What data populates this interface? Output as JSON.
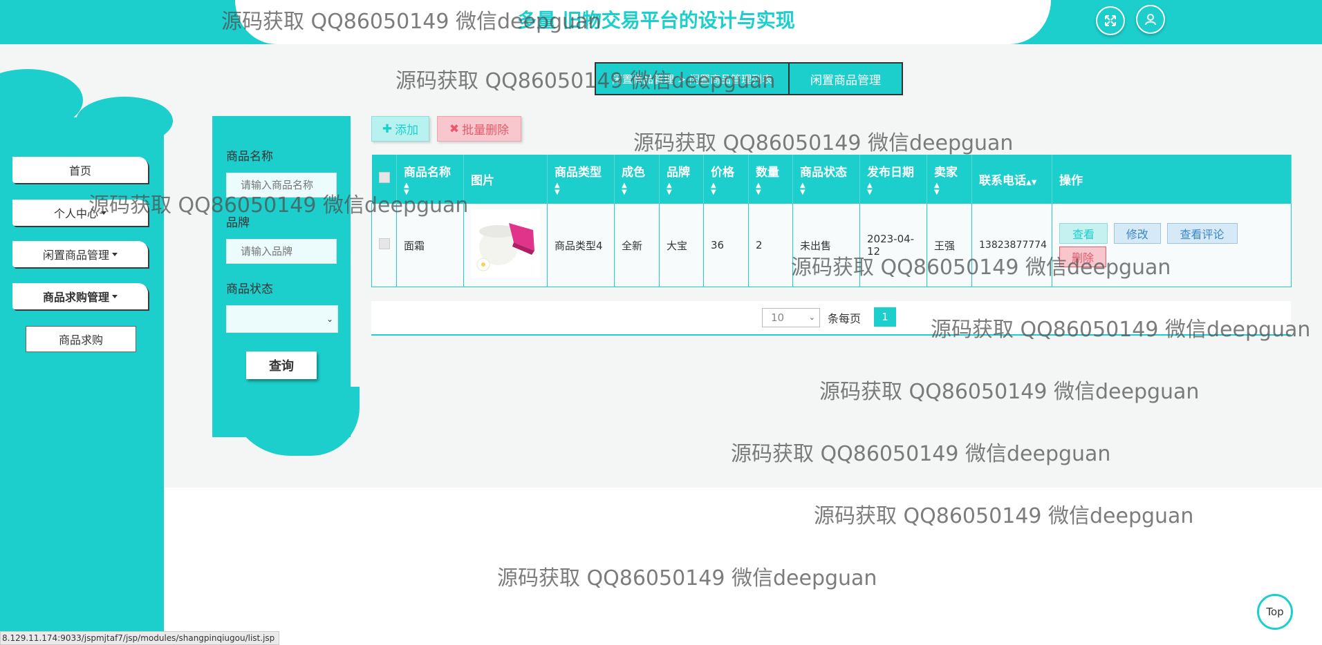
{
  "header": {
    "title": "多量 旧物交易平台的设计与实现",
    "fullscreen_icon": "expand-icon",
    "user_icon": "user-icon"
  },
  "sidebar": {
    "items": [
      {
        "label": "首页"
      },
      {
        "label": "个人中心"
      },
      {
        "label": "闲置商品管理"
      },
      {
        "label": "商品求购管理"
      }
    ],
    "submenu": {
      "label": "商品求购"
    }
  },
  "breadcrumb": {
    "list_label": "闲置商品管理 > 闲置商品管理列表",
    "current": "闲置商品管理"
  },
  "search": {
    "name_label": "商品名称",
    "name_placeholder": "请输入商品名称",
    "brand_label": "品牌",
    "brand_placeholder": "请输入品牌",
    "status_label": "商品状态",
    "status_value": "",
    "query_label": "查询"
  },
  "actions": {
    "add_label": "添加",
    "batch_delete_label": "批量删除"
  },
  "table": {
    "headers": [
      "商品名称",
      "图片",
      "商品类型",
      "成色",
      "品牌",
      "价格",
      "数量",
      "商品状态",
      "发布日期",
      "卖家",
      "联系电话",
      "操作"
    ],
    "rows": [
      {
        "name": "面霜",
        "type": "商品类型4",
        "condition": "全新",
        "brand": "大宝",
        "price": "36",
        "quantity": "2",
        "status": "未出售",
        "date": "2023-04-12",
        "seller": "王强",
        "phone": "13823877774",
        "view": "查看",
        "edit": "修改",
        "review": "查看评论",
        "delete": "删除"
      }
    ]
  },
  "pager": {
    "page_size": "10",
    "per_page_label": "条每页",
    "current_page": "1"
  },
  "top_button": "Top",
  "status_url": "8.129.11.174:9033/jspmjtaf7/jsp/modules/shangpinqiugou/list.jsp",
  "watermark": "源码获取 QQ86050149 微信deepguan",
  "colors": {
    "accent": "#1ccfcc",
    "danger": "#e85a6a",
    "info": "#3a86c8"
  }
}
